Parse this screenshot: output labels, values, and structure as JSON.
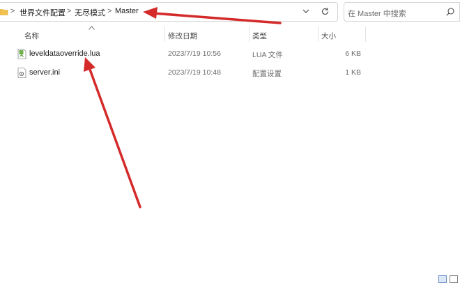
{
  "address_bar": {
    "breadcrumbs": [
      "世界文件配置",
      "无尽模式",
      "Master"
    ],
    "separator": ">"
  },
  "search": {
    "placeholder": "在 Master 中搜索"
  },
  "columns": {
    "name": "名称",
    "modified": "修改日期",
    "type": "类型",
    "size": "大小"
  },
  "files": [
    {
      "name": "leveldataoverride.lua",
      "modified": "2023/7/19 10:56",
      "type": "LUA 文件",
      "size": "6 KB",
      "icon": "lua-file-icon"
    },
    {
      "name": "server.ini",
      "modified": "2023/7/19 10:48",
      "type": "配置设置",
      "size": "1 KB",
      "icon": "ini-file-icon"
    }
  ],
  "colors": {
    "annotation_arrow": "#d42a2a",
    "folder": "#f2c14e",
    "border": "#d4d4d4"
  }
}
